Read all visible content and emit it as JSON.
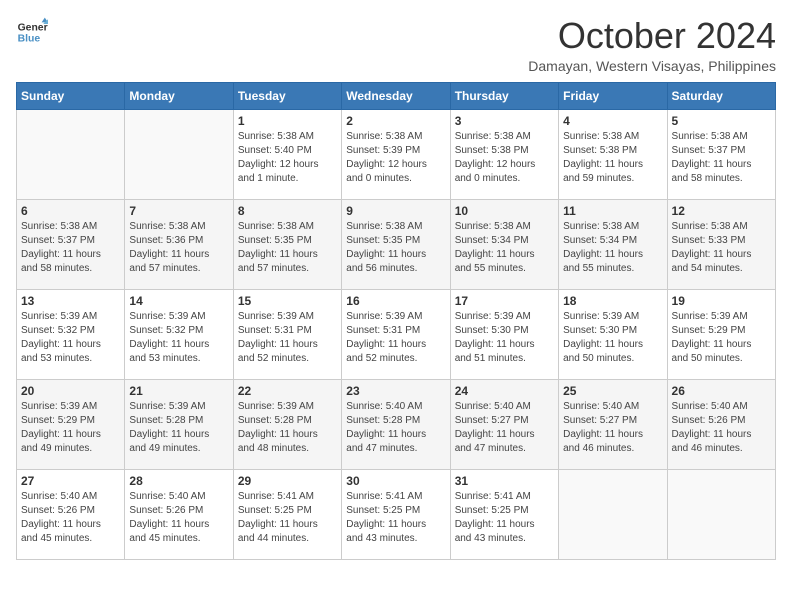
{
  "logo": {
    "line1": "General",
    "line2": "Blue"
  },
  "title": "October 2024",
  "location": "Damayan, Western Visayas, Philippines",
  "headers": [
    "Sunday",
    "Monday",
    "Tuesday",
    "Wednesday",
    "Thursday",
    "Friday",
    "Saturday"
  ],
  "weeks": [
    [
      {
        "day": "",
        "info": ""
      },
      {
        "day": "",
        "info": ""
      },
      {
        "day": "1",
        "info": "Sunrise: 5:38 AM\nSunset: 5:40 PM\nDaylight: 12 hours\nand 1 minute."
      },
      {
        "day": "2",
        "info": "Sunrise: 5:38 AM\nSunset: 5:39 PM\nDaylight: 12 hours\nand 0 minutes."
      },
      {
        "day": "3",
        "info": "Sunrise: 5:38 AM\nSunset: 5:38 PM\nDaylight: 12 hours\nand 0 minutes."
      },
      {
        "day": "4",
        "info": "Sunrise: 5:38 AM\nSunset: 5:38 PM\nDaylight: 11 hours\nand 59 minutes."
      },
      {
        "day": "5",
        "info": "Sunrise: 5:38 AM\nSunset: 5:37 PM\nDaylight: 11 hours\nand 58 minutes."
      }
    ],
    [
      {
        "day": "6",
        "info": "Sunrise: 5:38 AM\nSunset: 5:37 PM\nDaylight: 11 hours\nand 58 minutes."
      },
      {
        "day": "7",
        "info": "Sunrise: 5:38 AM\nSunset: 5:36 PM\nDaylight: 11 hours\nand 57 minutes."
      },
      {
        "day": "8",
        "info": "Sunrise: 5:38 AM\nSunset: 5:35 PM\nDaylight: 11 hours\nand 57 minutes."
      },
      {
        "day": "9",
        "info": "Sunrise: 5:38 AM\nSunset: 5:35 PM\nDaylight: 11 hours\nand 56 minutes."
      },
      {
        "day": "10",
        "info": "Sunrise: 5:38 AM\nSunset: 5:34 PM\nDaylight: 11 hours\nand 55 minutes."
      },
      {
        "day": "11",
        "info": "Sunrise: 5:38 AM\nSunset: 5:34 PM\nDaylight: 11 hours\nand 55 minutes."
      },
      {
        "day": "12",
        "info": "Sunrise: 5:38 AM\nSunset: 5:33 PM\nDaylight: 11 hours\nand 54 minutes."
      }
    ],
    [
      {
        "day": "13",
        "info": "Sunrise: 5:39 AM\nSunset: 5:32 PM\nDaylight: 11 hours\nand 53 minutes."
      },
      {
        "day": "14",
        "info": "Sunrise: 5:39 AM\nSunset: 5:32 PM\nDaylight: 11 hours\nand 53 minutes."
      },
      {
        "day": "15",
        "info": "Sunrise: 5:39 AM\nSunset: 5:31 PM\nDaylight: 11 hours\nand 52 minutes."
      },
      {
        "day": "16",
        "info": "Sunrise: 5:39 AM\nSunset: 5:31 PM\nDaylight: 11 hours\nand 52 minutes."
      },
      {
        "day": "17",
        "info": "Sunrise: 5:39 AM\nSunset: 5:30 PM\nDaylight: 11 hours\nand 51 minutes."
      },
      {
        "day": "18",
        "info": "Sunrise: 5:39 AM\nSunset: 5:30 PM\nDaylight: 11 hours\nand 50 minutes."
      },
      {
        "day": "19",
        "info": "Sunrise: 5:39 AM\nSunset: 5:29 PM\nDaylight: 11 hours\nand 50 minutes."
      }
    ],
    [
      {
        "day": "20",
        "info": "Sunrise: 5:39 AM\nSunset: 5:29 PM\nDaylight: 11 hours\nand 49 minutes."
      },
      {
        "day": "21",
        "info": "Sunrise: 5:39 AM\nSunset: 5:28 PM\nDaylight: 11 hours\nand 49 minutes."
      },
      {
        "day": "22",
        "info": "Sunrise: 5:39 AM\nSunset: 5:28 PM\nDaylight: 11 hours\nand 48 minutes."
      },
      {
        "day": "23",
        "info": "Sunrise: 5:40 AM\nSunset: 5:28 PM\nDaylight: 11 hours\nand 47 minutes."
      },
      {
        "day": "24",
        "info": "Sunrise: 5:40 AM\nSunset: 5:27 PM\nDaylight: 11 hours\nand 47 minutes."
      },
      {
        "day": "25",
        "info": "Sunrise: 5:40 AM\nSunset: 5:27 PM\nDaylight: 11 hours\nand 46 minutes."
      },
      {
        "day": "26",
        "info": "Sunrise: 5:40 AM\nSunset: 5:26 PM\nDaylight: 11 hours\nand 46 minutes."
      }
    ],
    [
      {
        "day": "27",
        "info": "Sunrise: 5:40 AM\nSunset: 5:26 PM\nDaylight: 11 hours\nand 45 minutes."
      },
      {
        "day": "28",
        "info": "Sunrise: 5:40 AM\nSunset: 5:26 PM\nDaylight: 11 hours\nand 45 minutes."
      },
      {
        "day": "29",
        "info": "Sunrise: 5:41 AM\nSunset: 5:25 PM\nDaylight: 11 hours\nand 44 minutes."
      },
      {
        "day": "30",
        "info": "Sunrise: 5:41 AM\nSunset: 5:25 PM\nDaylight: 11 hours\nand 43 minutes."
      },
      {
        "day": "31",
        "info": "Sunrise: 5:41 AM\nSunset: 5:25 PM\nDaylight: 11 hours\nand 43 minutes."
      },
      {
        "day": "",
        "info": ""
      },
      {
        "day": "",
        "info": ""
      }
    ]
  ]
}
